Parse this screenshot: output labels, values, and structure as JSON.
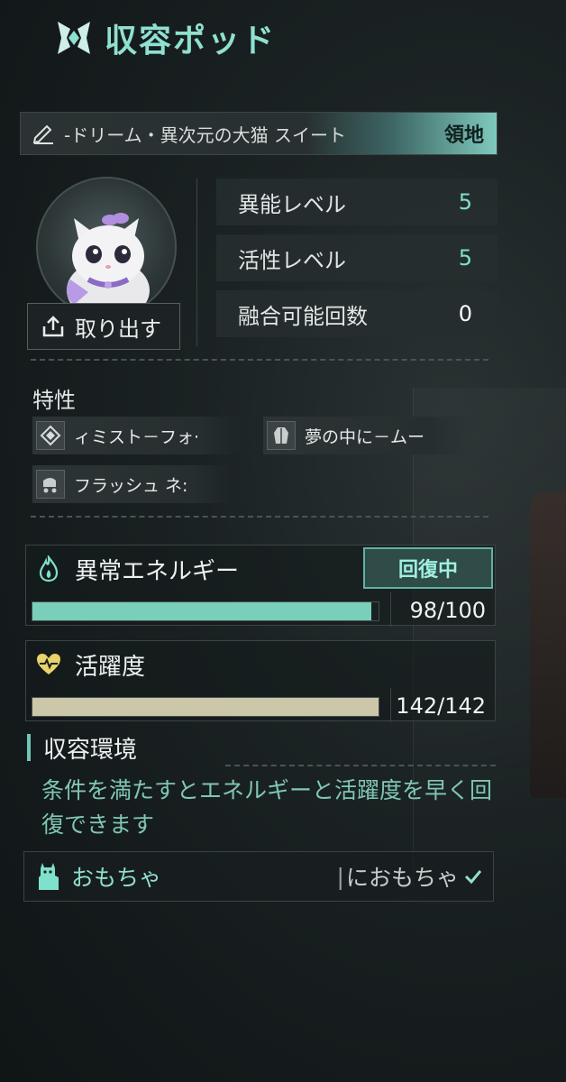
{
  "header": {
    "title": "収容ポッド"
  },
  "creature": {
    "name": "‐ドリーム・異次元の大猫  スイート",
    "territory_label": "領地"
  },
  "retrieve_button": {
    "label": "取り出す"
  },
  "stats": [
    {
      "label": "異能レベル",
      "value": "5"
    },
    {
      "label": "活性レベル",
      "value": "5"
    },
    {
      "label": "融合可能回数",
      "value": "0"
    }
  ],
  "traits": {
    "title": "特性",
    "items": [
      {
        "label": "ィミスト－フォ‧",
        "icon": "diamond-icon"
      },
      {
        "label": "夢の中に－ムー",
        "icon": "robe-icon"
      },
      {
        "label": "フラッシュ  ネ:",
        "icon": "pram-icon"
      }
    ]
  },
  "energy": {
    "title": "異常エネルギー",
    "status": "回復中",
    "current": 98,
    "max": 100,
    "value_text": "98/100",
    "fill_color": "#79cfb9"
  },
  "vitality": {
    "title": "活躍度",
    "current": 142,
    "max": 142,
    "value_text": "142/142",
    "fill_color": "#cbc7a8"
  },
  "environment": {
    "title": "収容環境",
    "description": "条件を満たすとエネルギーと活躍度を早く回復できます"
  },
  "toy": {
    "label": "おもちゃ",
    "status": "におもちゃ"
  },
  "colors": {
    "accent": "#8fe0d0",
    "badge_bg": "#2f4c49"
  }
}
